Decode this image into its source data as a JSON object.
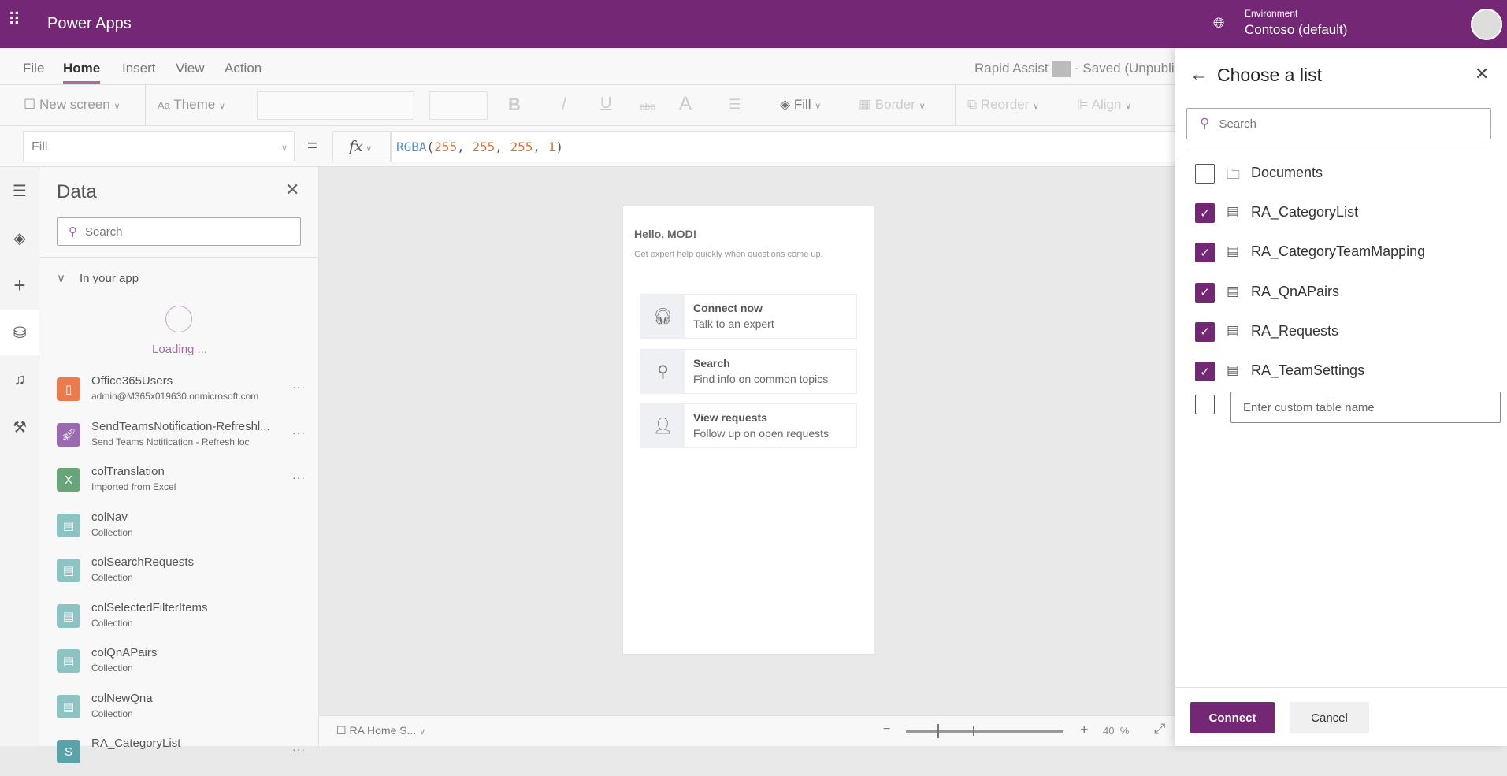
{
  "app": {
    "title": "Power Apps",
    "environment_label": "Environment",
    "environment": "Contoso (default)",
    "brand_color": "#742774"
  },
  "menu": {
    "items": [
      "File",
      "Home",
      "Insert",
      "View",
      "Action"
    ],
    "active": "Home",
    "doc_title": "Rapid Assist",
    "doc_status": "- Saved (Unpublis"
  },
  "toolbar": {
    "new_screen": "New screen",
    "theme": "Theme",
    "fill": "Fill",
    "border": "Border",
    "reorder": "Reorder",
    "align": "Align"
  },
  "formula": {
    "property": "Fill",
    "equals": "=",
    "fx": "fx",
    "fn": "RGBA",
    "open": "(",
    "args": [
      "255",
      "255",
      "255",
      "1"
    ],
    "close": ")"
  },
  "data_panel": {
    "title": "Data",
    "search_placeholder": "Search",
    "section": "In your app",
    "loading": "Loading ...",
    "items": [
      {
        "name": "Office365Users",
        "sub": "admin@M365x019630.onmicrosoft.com",
        "icon": "office-icon",
        "color": "#eb7a4e",
        "more": true
      },
      {
        "name": "SendTeamsNotification-Refreshl...",
        "sub": "Send Teams Notification - Refresh loc",
        "icon": "rocket-icon",
        "color": "#9a6aae",
        "more": true
      },
      {
        "name": "colTranslation",
        "sub": "Imported from Excel",
        "icon": "excel-icon",
        "color": "#6aa57a",
        "more": true
      },
      {
        "name": "colNav",
        "sub": "Collection",
        "icon": "collection-icon",
        "color": "#8ec3c4",
        "more": false
      },
      {
        "name": "colSearchRequests",
        "sub": "Collection",
        "icon": "collection-icon",
        "color": "#8ec3c4",
        "more": false
      },
      {
        "name": "colSelectedFilterItems",
        "sub": "Collection",
        "icon": "collection-icon",
        "color": "#8ec3c4",
        "more": false
      },
      {
        "name": "colQnAPairs",
        "sub": "Collection",
        "icon": "collection-icon",
        "color": "#8ec3c4",
        "more": false
      },
      {
        "name": "colNewQna",
        "sub": "Collection",
        "icon": "collection-icon",
        "color": "#8ec3c4",
        "more": false
      },
      {
        "name": "RA_CategoryList",
        "sub": "",
        "icon": "sharepoint-icon",
        "color": "#5aa3a8",
        "more": true
      }
    ]
  },
  "canvas": {
    "greeting": "Hello, MOD!",
    "subtitle": "Get expert help quickly when questions come up.",
    "tiles": [
      {
        "title": "Connect now",
        "sub": "Talk to an expert",
        "icon": "headset-icon"
      },
      {
        "title": "Search",
        "sub": "Find info on common topics",
        "icon": "search-help-icon"
      },
      {
        "title": "View requests",
        "sub": "Follow up on open requests",
        "icon": "person-requests-icon"
      }
    ]
  },
  "status": {
    "screen": "RA Home S...",
    "zoom_value": "40",
    "zoom_unit": "%",
    "zoom_percent": 40
  },
  "choose_list": {
    "title": "Choose a list",
    "search_placeholder": "Search",
    "custom_placeholder": "Enter custom table name",
    "items": [
      {
        "label": "Documents",
        "checked": false,
        "icon": "library-icon"
      },
      {
        "label": "RA_CategoryList",
        "checked": true,
        "icon": "list-icon"
      },
      {
        "label": "RA_CategoryTeamMapping",
        "checked": true,
        "icon": "list-icon"
      },
      {
        "label": "RA_QnAPairs",
        "checked": true,
        "icon": "list-icon"
      },
      {
        "label": "RA_Requests",
        "checked": true,
        "icon": "list-icon"
      },
      {
        "label": "RA_TeamSettings",
        "checked": true,
        "icon": "list-icon"
      }
    ],
    "connect": "Connect",
    "cancel": "Cancel"
  }
}
